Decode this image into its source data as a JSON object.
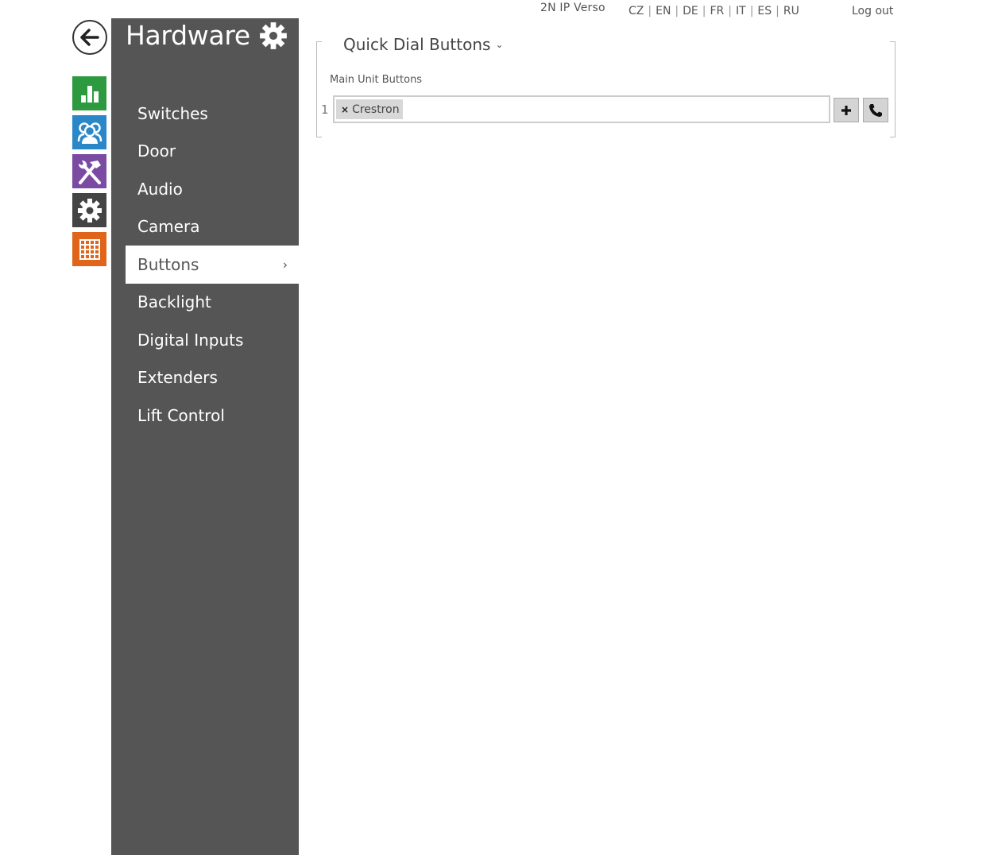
{
  "header": {
    "device_name": "2N IP Verso",
    "languages": [
      "CZ",
      "EN",
      "DE",
      "FR",
      "IT",
      "ES",
      "RU"
    ],
    "logout_label": "Log out"
  },
  "app_icons": [
    {
      "name": "status-icon",
      "color": "#2e9a3f"
    },
    {
      "name": "directory-icon",
      "color": "#2a88c8"
    },
    {
      "name": "hardware-icon",
      "color": "#7b4aa3"
    },
    {
      "name": "services-icon",
      "color": "#444444"
    },
    {
      "name": "system-icon",
      "color": "#e0641a"
    }
  ],
  "sidebar": {
    "title": "Hardware",
    "items": [
      {
        "label": "Switches"
      },
      {
        "label": "Door"
      },
      {
        "label": "Audio"
      },
      {
        "label": "Camera"
      },
      {
        "label": "Buttons",
        "active": true
      },
      {
        "label": "Backlight"
      },
      {
        "label": "Digital Inputs"
      },
      {
        "label": "Extenders"
      },
      {
        "label": "Lift Control"
      }
    ]
  },
  "main": {
    "section_title": "Quick Dial Buttons",
    "field_label": "Main Unit Buttons",
    "rows": [
      {
        "number": "1",
        "tags": [
          "Crestron"
        ]
      }
    ]
  }
}
